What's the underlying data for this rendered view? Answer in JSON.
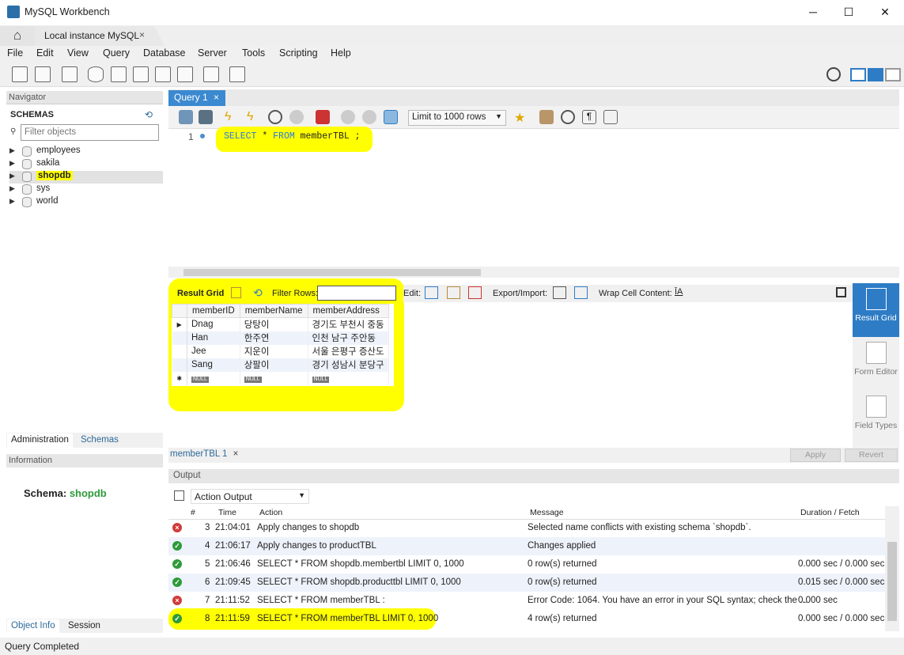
{
  "window": {
    "title": "MySQL Workbench",
    "minimize": "─",
    "maximize": "☐",
    "close": "✕"
  },
  "tabs": {
    "home_icon": "home-icon",
    "instance": "Local instance MySQL",
    "close": "×"
  },
  "menu": [
    "File",
    "Edit",
    "View",
    "Query",
    "Database",
    "Server",
    "Tools",
    "Scripting",
    "Help"
  ],
  "navigator": {
    "header": "Navigator",
    "schemas_title": "SCHEMAS",
    "filter_placeholder": "Filter objects",
    "schemas": [
      "employees",
      "sakila",
      "shopdb",
      "sys",
      "world"
    ],
    "selected": "shopdb",
    "tabs": [
      "Administration",
      "Schemas"
    ]
  },
  "information": {
    "header": "Information",
    "label": "Schema: ",
    "value": "shopdb",
    "tabs": [
      "Object Info",
      "Session"
    ]
  },
  "query_tab": {
    "label": "Query 1",
    "close": "×"
  },
  "limit": "Limit to 1000 rows",
  "editor": {
    "line": "1",
    "sql_kw1": "SELECT",
    "sql_rest1": " * ",
    "sql_kw2": "FROM",
    "sql_rest2": " memberTBL ;"
  },
  "result_toolbar": {
    "result_grid": "Result Grid",
    "filter_rows": "Filter Rows:",
    "edit": "Edit:",
    "export_import": "Export/Import:",
    "wrap": "Wrap Cell Content:"
  },
  "result_grid": {
    "columns": [
      "memberID",
      "memberName",
      "memberAddress"
    ],
    "rows": [
      [
        "Dnag",
        "당탕이",
        "경기도 부천시 중동"
      ],
      [
        "Han",
        "한주연",
        "인천 남구 주안동"
      ],
      [
        "Jee",
        "지운이",
        "서울 은평구 증산도"
      ],
      [
        "Sang",
        "상팔이",
        "경기 성남시 분당구"
      ]
    ],
    "null": "NULL"
  },
  "side_panel": [
    {
      "label": "Result Grid"
    },
    {
      "label": "Form Editor"
    },
    {
      "label": "Field Types"
    }
  ],
  "result_tab": {
    "label": "memberTBL 1",
    "close": "×",
    "apply": "Apply",
    "revert": "Revert"
  },
  "output": {
    "header": "Output",
    "selector": "Action Output",
    "columns": [
      "#",
      "Time",
      "Action",
      "Message",
      "Duration / Fetch"
    ],
    "rows": [
      {
        "status": "err",
        "num": "3",
        "time": "21:04:01",
        "action": "Apply changes to shopdb",
        "message": "Selected name conflicts with existing schema `shopdb`.",
        "duration": ""
      },
      {
        "status": "ok",
        "num": "4",
        "time": "21:06:17",
        "action": "Apply changes to productTBL",
        "message": "Changes applied",
        "duration": ""
      },
      {
        "status": "ok",
        "num": "5",
        "time": "21:06:46",
        "action": "SELECT * FROM shopdb.membertbl LIMIT 0, 1000",
        "message": "0 row(s) returned",
        "duration": "0.000 sec / 0.000 sec"
      },
      {
        "status": "ok",
        "num": "6",
        "time": "21:09:45",
        "action": "SELECT * FROM shopdb.producttbl LIMIT 0, 1000",
        "message": "0 row(s) returned",
        "duration": "0.015 sec / 0.000 sec"
      },
      {
        "status": "err",
        "num": "7",
        "time": "21:11:52",
        "action": "SELECT * FROM memberTBL :",
        "message": "Error Code: 1064. You have an error in your SQL syntax; check the ...",
        "duration": "0.000 sec"
      },
      {
        "status": "ok",
        "num": "8",
        "time": "21:11:59",
        "action": "SELECT * FROM memberTBL LIMIT 0, 1000",
        "message": "4 row(s) returned",
        "duration": "0.000 sec / 0.000 sec"
      }
    ]
  },
  "status": "Query Completed",
  "colors": {
    "accent": "#3b89d0",
    "highlight": "#ffff00",
    "ok": "#2e9a3b",
    "error": "#d13a3a"
  }
}
